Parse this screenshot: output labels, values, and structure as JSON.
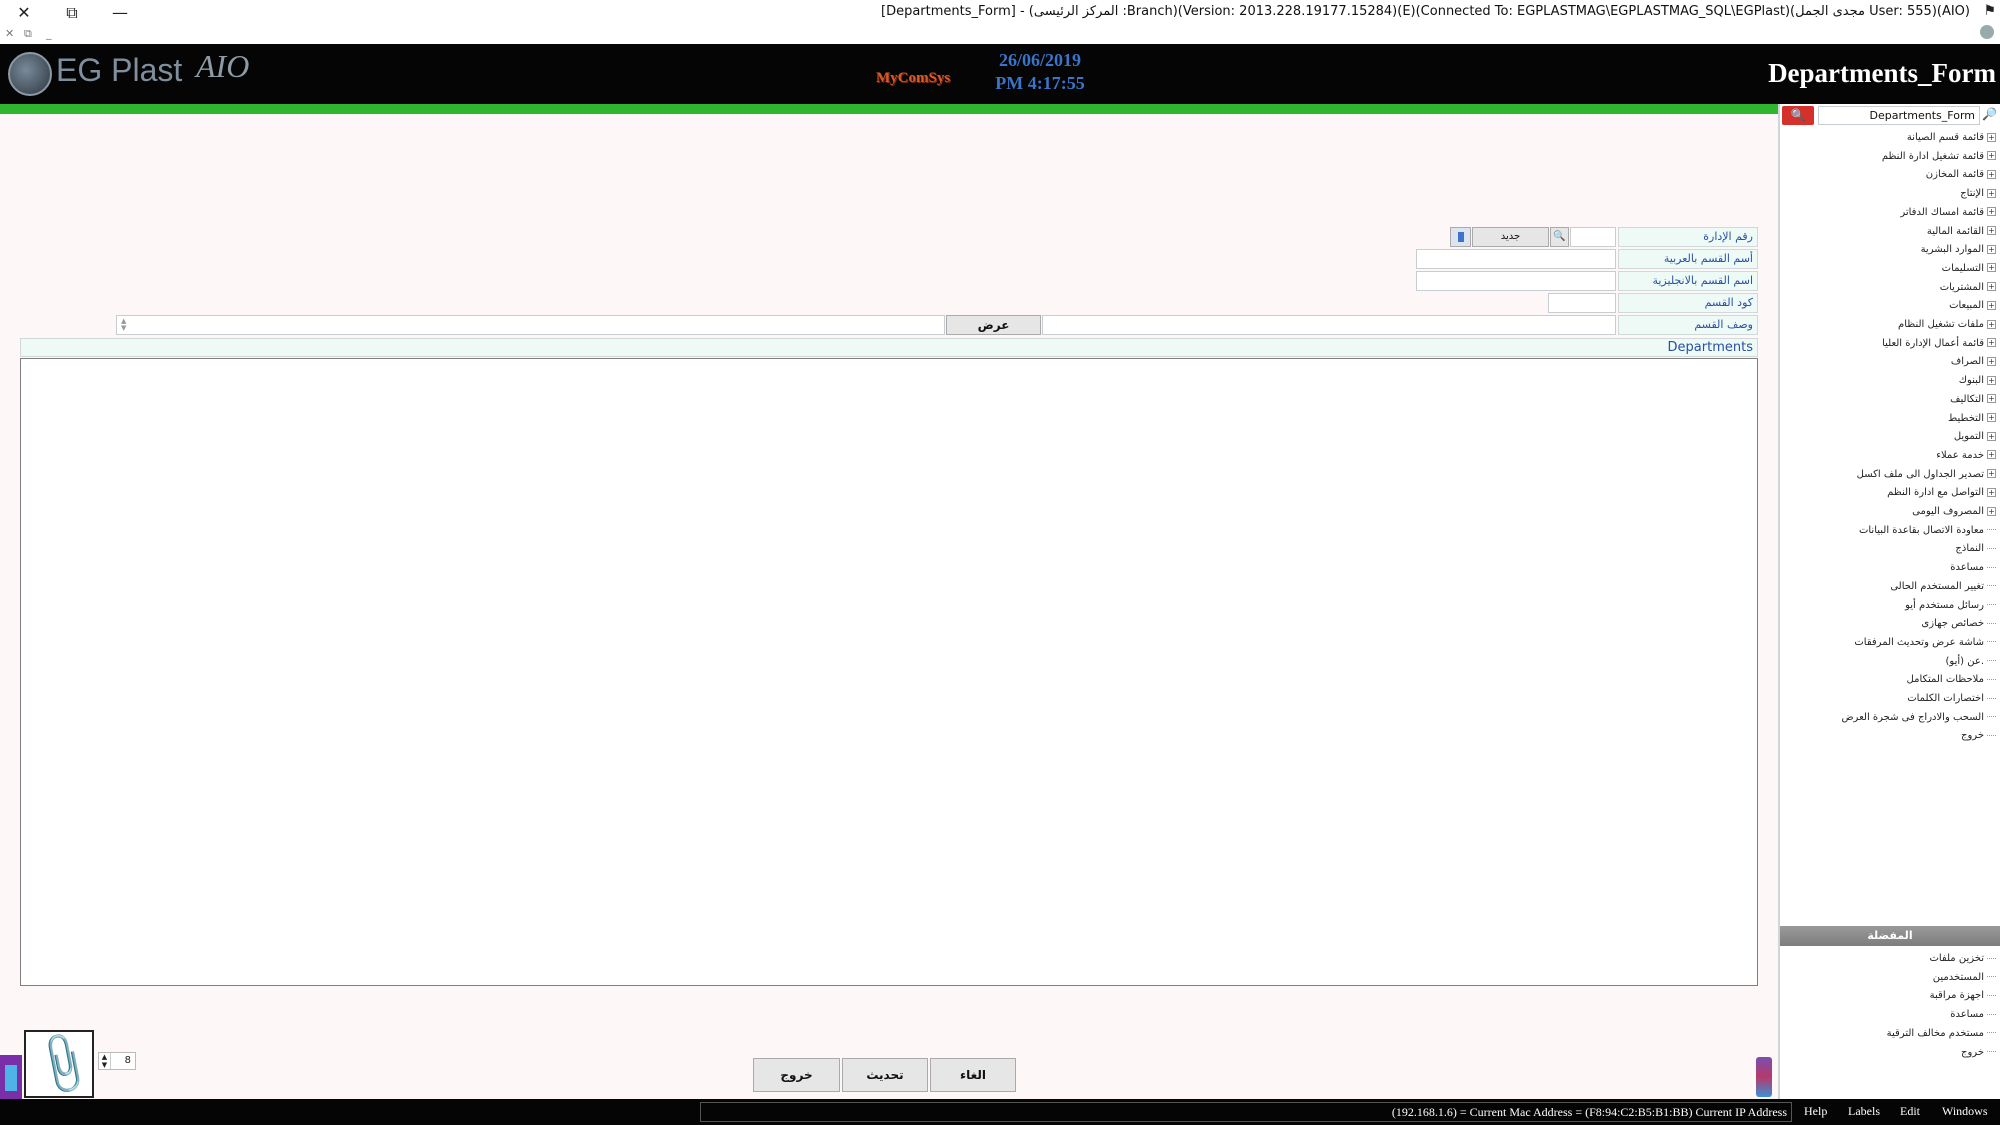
{
  "window": {
    "title": "[Departments_Form] - (المركز الرئيسى :Branch)(Version: 2013.228.19177.15284)(E)(Connected To: EGPLASTMAG\\EGPLASTMAG_SQL\\EGPlast)(مجدى الجمل User: 555)(AIO)",
    "close_glyph": "✕",
    "restore_glyph": "⧉",
    "minimize_glyph": "—",
    "flag_glyph": "⚑",
    "mdi_close": "✕",
    "mdi_restore": "⧉",
    "mdi_minimize": "_"
  },
  "header": {
    "logo_text": "EG Plast",
    "logo_suffix": "AIO",
    "mycomsys": "MyComSys",
    "date": "26/06/2019",
    "time": "PM 4:17:55",
    "form_title": "Departments_Form"
  },
  "form": {
    "dept_no_label": "رقم الإدارة",
    "new_button": "جديد",
    "search_glyph": "🔍",
    "arabic_name_label": "أسم القسم بالعربية",
    "english_name_label": "اسم القسم بالانجليزية",
    "dept_code_label": "كود القسم",
    "dept_desc_label": "وصف القسم",
    "view_button": "عرض",
    "grid_title": "Departments"
  },
  "footer": {
    "cancel_button": "الغاء",
    "update_button": "تحديث",
    "exit_button": "خروج",
    "attachments_count": "8",
    "clip_glyph": "📎"
  },
  "side_panel": {
    "search_value": "Departments_Form",
    "search_btn_glyph": "🔍",
    "search_icon_glyph": "🔎",
    "menu_items": [
      {
        "label": "قائمة قسم الصيانة",
        "expandable": true
      },
      {
        "label": "قائمة تشغيل ادارة النظم",
        "expandable": true
      },
      {
        "label": "قائمة المخازن",
        "expandable": true
      },
      {
        "label": "الإنتاج",
        "expandable": true
      },
      {
        "label": "قائمة امساك الدفاتر",
        "expandable": true
      },
      {
        "label": "القائمة المالية",
        "expandable": true
      },
      {
        "label": "الموارد البشرية",
        "expandable": true
      },
      {
        "label": "التسليمات",
        "expandable": true
      },
      {
        "label": "المشتريات",
        "expandable": true
      },
      {
        "label": "المبيعات",
        "expandable": true
      },
      {
        "label": "ملفات تشغيل النظام",
        "expandable": true
      },
      {
        "label": "قائمة أعمال الإدارة العليا",
        "expandable": true
      },
      {
        "label": "الصراف",
        "expandable": true
      },
      {
        "label": "البنوك",
        "expandable": true
      },
      {
        "label": "التكاليف",
        "expandable": true
      },
      {
        "label": "التخطيط",
        "expandable": true
      },
      {
        "label": "التمويل",
        "expandable": true
      },
      {
        "label": "خدمة عملاء",
        "expandable": true
      },
      {
        "label": "تصدير الجداول الى ملف اكسل",
        "expandable": true
      },
      {
        "label": "التواصل مع ادارة النظم",
        "expandable": true
      },
      {
        "label": "المصروف اليومى",
        "expandable": true
      },
      {
        "label": "معاودة الاتصال بقاعدة البيانات",
        "expandable": false
      },
      {
        "label": "النماذج",
        "expandable": false
      },
      {
        "label": "مساعدة",
        "expandable": false
      },
      {
        "label": "تغيير المستخدم الحالى",
        "expandable": false
      },
      {
        "label": "رسائل مستخدم أيو",
        "expandable": false
      },
      {
        "label": "خصائص جهازى",
        "expandable": false
      },
      {
        "label": "شاشة عرض وتحديث المرفقات",
        "expandable": false
      },
      {
        "label": "عن (أيو).",
        "expandable": false
      },
      {
        "label": "ملاحظات المتكامل",
        "expandable": false
      },
      {
        "label": "اختصارات الكلمات",
        "expandable": false
      },
      {
        "label": "السحب والادراج فى شجرة العرض",
        "expandable": false
      },
      {
        "label": "خروج",
        "expandable": false
      }
    ],
    "favorites_title": "المفضلة",
    "favorites": [
      {
        "label": "تخزين ملفات"
      },
      {
        "label": "المستخدمين"
      },
      {
        "label": "اجهزة مراقبة"
      },
      {
        "label": "مساعدة"
      },
      {
        "label": "مستخدم مخالف الترقية"
      },
      {
        "label": "خروج"
      }
    ]
  },
  "status_bar": {
    "ip_info": "(192.168.1.6) = Current Mac Address = (F8:94:C2:B5:B1:BB) Current IP Address",
    "menu_help": "Help",
    "menu_labels": "Labels",
    "menu_edit": "Edit",
    "menu_windows": "Windows"
  },
  "colors": {
    "accent_blue": "#3b74c8",
    "progress_green": "#2fb52f",
    "search_red": "#d4302c",
    "label_bg": "#edfaf6",
    "label_text": "#2b4fa6"
  }
}
